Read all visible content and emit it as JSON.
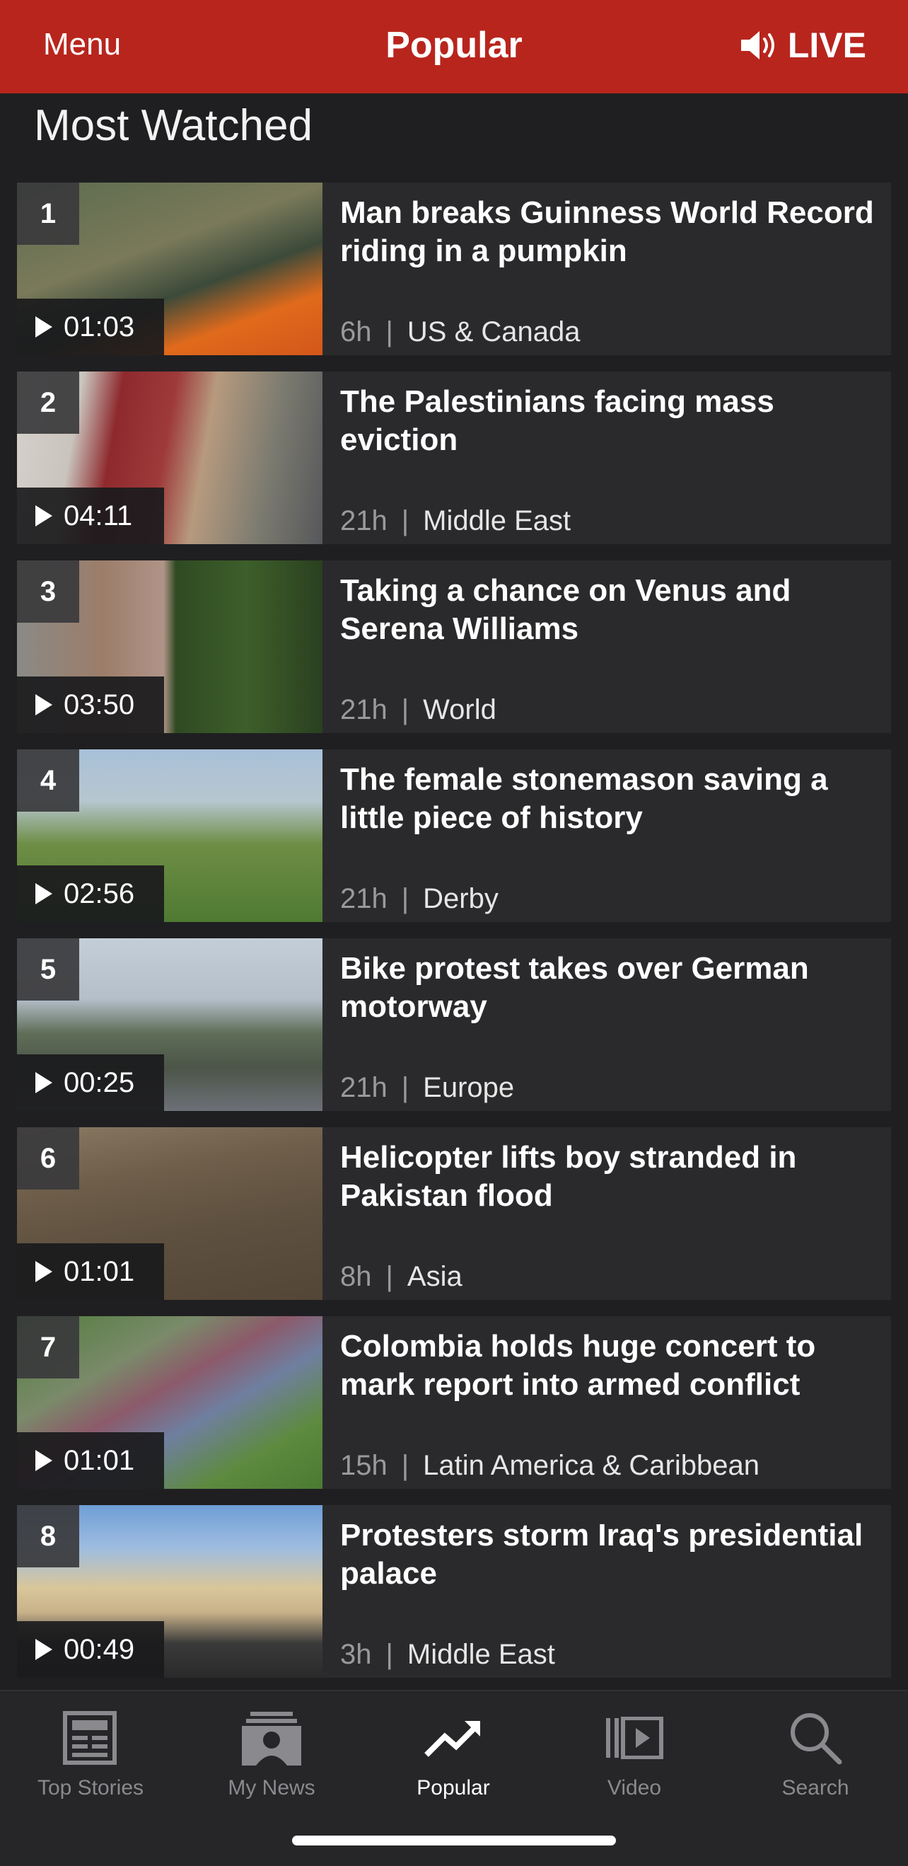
{
  "header": {
    "menu_label": "Menu",
    "title": "Popular",
    "live_label": "LIVE",
    "color": "#b8251d"
  },
  "section_title": "Most Watched",
  "videos": [
    {
      "rank": "1",
      "duration": "01:03",
      "headline": "Man breaks Guinness World Record riding in a pumpkin",
      "age": "6h",
      "category": "US & Canada"
    },
    {
      "rank": "2",
      "duration": "04:11",
      "headline": "The Palestinians facing mass eviction",
      "age": "21h",
      "category": "Middle East"
    },
    {
      "rank": "3",
      "duration": "03:50",
      "headline": "Taking a chance on Venus and Serena Williams",
      "age": "21h",
      "category": "World"
    },
    {
      "rank": "4",
      "duration": "02:56",
      "headline": "The female stonemason saving a little piece of history",
      "age": "21h",
      "category": "Derby"
    },
    {
      "rank": "5",
      "duration": "00:25",
      "headline": "Bike protest takes over German motorway",
      "age": "21h",
      "category": "Europe"
    },
    {
      "rank": "6",
      "duration": "01:01",
      "headline": "Helicopter lifts boy stranded in Pakistan flood",
      "age": "8h",
      "category": "Asia"
    },
    {
      "rank": "7",
      "duration": "01:01",
      "headline": "Colombia holds huge concert to mark report into armed conflict",
      "age": "15h",
      "category": "Latin America & Caribbean"
    },
    {
      "rank": "8",
      "duration": "00:49",
      "headline": "Protesters storm Iraq's presidential palace",
      "age": "3h",
      "category": "Middle East"
    }
  ],
  "meta_separator": "|",
  "tabs": [
    {
      "label": "Top Stories",
      "icon": "newspaper-icon"
    },
    {
      "label": "My News",
      "icon": "my-news-icon"
    },
    {
      "label": "Popular",
      "icon": "trending-icon",
      "active": true
    },
    {
      "label": "Video",
      "icon": "video-icon"
    },
    {
      "label": "Search",
      "icon": "search-icon"
    }
  ]
}
